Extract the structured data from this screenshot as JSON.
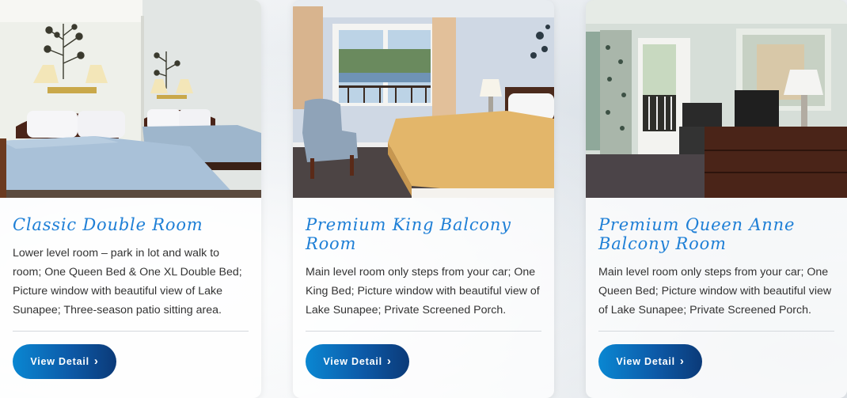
{
  "rooms": [
    {
      "title": "Classic Double Room",
      "description": "Lower level room – park in lot and walk to room; One Queen Bed & One XL Double Bed; Picture window with beautiful view of Lake Sunapee; Three-season patio sitting area.",
      "button_label": "View Detail",
      "button_icon": "chevron-right-icon"
    },
    {
      "title": "Premium King Balcony Room",
      "description": "Main level room only steps from your car; One King Bed; Picture window with beautiful view of Lake Sunapee; Private Screened Porch.",
      "button_label": "View Detail",
      "button_icon": "chevron-right-icon"
    },
    {
      "title": "Premium Queen Anne Balcony Room",
      "description": "Main level room only steps from your car; One Queen Bed; Picture window with beautiful view of Lake Sunapee; Private Screened Porch.",
      "button_label": "View Detail",
      "button_icon": "chevron-right-icon"
    }
  ],
  "colors": {
    "title": "#1e7fd6",
    "button_start": "#0a87d2",
    "button_end": "#0b3a78",
    "text": "#333333"
  }
}
